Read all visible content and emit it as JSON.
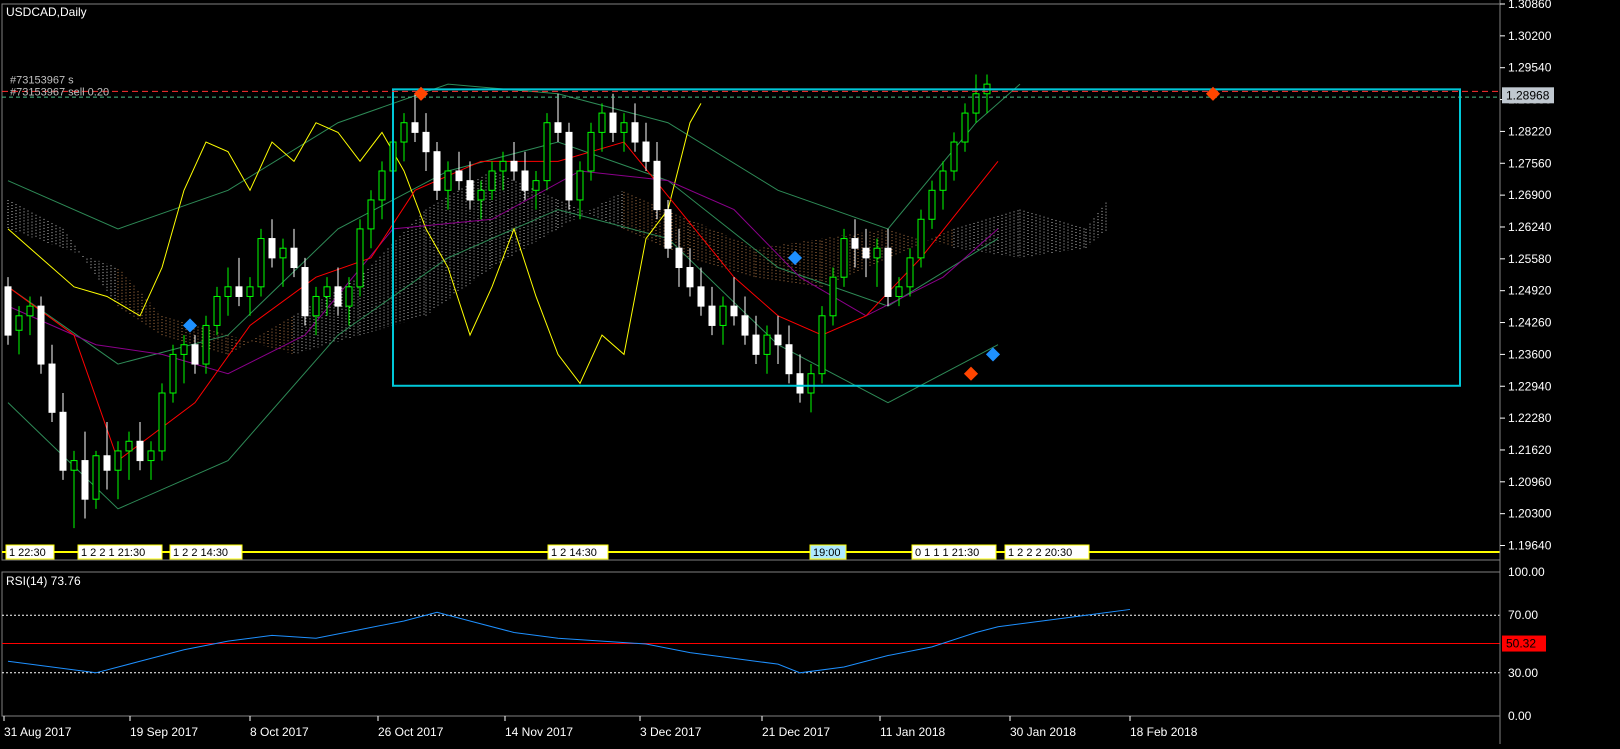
{
  "window": {
    "title": "USDCAD,Daily"
  },
  "order": {
    "label1": "#73153967 s",
    "label2": "#73153967 sell 0.20"
  },
  "colors": {
    "background": "#000000",
    "bull": "#00ff00",
    "bear": "#ffffff",
    "grid": "#ffffff",
    "box": "#00c8d8",
    "tenkan": "#ff0000",
    "kijun": "#8b008b",
    "chikou": "#ffff00",
    "bands": "#2e8b57",
    "rsi": "#1e90ff",
    "rsi_mid": "#ff0000",
    "price_tag": "#c0c8d0",
    "rsi_tag": "#ff0000"
  },
  "price_axis": {
    "ticks": [
      "1.30860",
      "1.30200",
      "1.29540",
      "1.28880",
      "1.28220",
      "1.27560",
      "1.26900",
      "1.26240",
      "1.25580",
      "1.24920",
      "1.24260",
      "1.23600",
      "1.22940",
      "1.22280",
      "1.21620",
      "1.20960",
      "1.20300",
      "1.19640"
    ],
    "current_price": "1.28968"
  },
  "rsi_panel": {
    "label": "RSI(14) 73.76",
    "ticks": [
      "100.00",
      "70.00",
      "30.00",
      "0.00"
    ],
    "level_value": "50.32"
  },
  "time_axis": {
    "labels": [
      "31 Aug 2017",
      "19 Sep 2017",
      "8 Oct 2017",
      "26 Oct 2017",
      "14 Nov 2017",
      "3 Dec 2017",
      "21 Dec 2017",
      "11 Jan 2018",
      "30 Jan 2018",
      "18 Feb 2018"
    ]
  },
  "events": [
    {
      "label": "1 22:30",
      "bg": "#ffffff"
    },
    {
      "label": "1 2 2 1 21:30",
      "bg": "#ffffff"
    },
    {
      "label": "1 2 2 14:30",
      "bg": "#ffffff"
    },
    {
      "label": "1 2 14:30",
      "bg": "#ffffff"
    },
    {
      "label": "19:00",
      "bg": "#aee9ff"
    },
    {
      "label": "0 1 1 1 21:30",
      "bg": "#ffffff"
    },
    {
      "label": "1 2 2 2 20:30",
      "bg": "#ffffff"
    }
  ],
  "chart_data": {
    "type": "candlestick",
    "symbol": "USDCAD",
    "timeframe": "Daily",
    "ylim": [
      1.1934,
      1.3086
    ],
    "candles": [
      [
        1.25,
        1.252,
        1.238,
        1.24
      ],
      [
        1.241,
        1.246,
        1.236,
        1.244
      ],
      [
        1.244,
        1.248,
        1.24,
        1.246
      ],
      [
        1.246,
        1.248,
        1.232,
        1.234
      ],
      [
        1.234,
        1.238,
        1.222,
        1.224
      ],
      [
        1.224,
        1.228,
        1.21,
        1.212
      ],
      [
        1.212,
        1.216,
        1.2,
        1.214
      ],
      [
        1.214,
        1.22,
        1.202,
        1.206
      ],
      [
        1.206,
        1.216,
        1.204,
        1.215
      ],
      [
        1.215,
        1.222,
        1.208,
        1.212
      ],
      [
        1.212,
        1.218,
        1.206,
        1.216
      ],
      [
        1.216,
        1.22,
        1.21,
        1.218
      ],
      [
        1.218,
        1.222,
        1.212,
        1.214
      ],
      [
        1.214,
        1.218,
        1.21,
        1.216
      ],
      [
        1.216,
        1.23,
        1.214,
        1.228
      ],
      [
        1.228,
        1.238,
        1.226,
        1.236
      ],
      [
        1.236,
        1.24,
        1.23,
        1.238
      ],
      [
        1.238,
        1.24,
        1.232,
        1.234
      ],
      [
        1.234,
        1.244,
        1.232,
        1.242
      ],
      [
        1.242,
        1.25,
        1.24,
        1.248
      ],
      [
        1.248,
        1.254,
        1.244,
        1.25
      ],
      [
        1.25,
        1.256,
        1.246,
        1.248
      ],
      [
        1.248,
        1.252,
        1.244,
        1.25
      ],
      [
        1.25,
        1.262,
        1.248,
        1.26
      ],
      [
        1.26,
        1.264,
        1.254,
        1.256
      ],
      [
        1.256,
        1.26,
        1.25,
        1.258
      ],
      [
        1.258,
        1.262,
        1.252,
        1.254
      ],
      [
        1.254,
        1.256,
        1.242,
        1.244
      ],
      [
        1.244,
        1.25,
        1.24,
        1.248
      ],
      [
        1.248,
        1.252,
        1.244,
        1.25
      ],
      [
        1.25,
        1.254,
        1.244,
        1.246
      ],
      [
        1.246,
        1.252,
        1.242,
        1.25
      ],
      [
        1.25,
        1.264,
        1.248,
        1.262
      ],
      [
        1.262,
        1.27,
        1.258,
        1.268
      ],
      [
        1.268,
        1.276,
        1.264,
        1.274
      ],
      [
        1.274,
        1.282,
        1.27,
        1.28
      ],
      [
        1.28,
        1.286,
        1.276,
        1.284
      ],
      [
        1.284,
        1.29,
        1.28,
        1.282
      ],
      [
        1.282,
        1.286,
        1.274,
        1.278
      ],
      [
        1.278,
        1.28,
        1.268,
        1.27
      ],
      [
        1.27,
        1.276,
        1.266,
        1.274
      ],
      [
        1.274,
        1.278,
        1.27,
        1.272
      ],
      [
        1.272,
        1.276,
        1.266,
        1.268
      ],
      [
        1.268,
        1.272,
        1.264,
        1.27
      ],
      [
        1.27,
        1.276,
        1.268,
        1.274
      ],
      [
        1.274,
        1.278,
        1.27,
        1.276
      ],
      [
        1.276,
        1.28,
        1.272,
        1.274
      ],
      [
        1.274,
        1.278,
        1.268,
        1.27
      ],
      [
        1.27,
        1.274,
        1.266,
        1.272
      ],
      [
        1.272,
        1.286,
        1.27,
        1.284
      ],
      [
        1.284,
        1.29,
        1.28,
        1.282
      ],
      [
        1.282,
        1.284,
        1.266,
        1.268
      ],
      [
        1.268,
        1.276,
        1.264,
        1.274
      ],
      [
        1.274,
        1.284,
        1.272,
        1.282
      ],
      [
        1.282,
        1.288,
        1.278,
        1.286
      ],
      [
        1.286,
        1.29,
        1.28,
        1.282
      ],
      [
        1.282,
        1.286,
        1.278,
        1.284
      ],
      [
        1.284,
        1.288,
        1.278,
        1.28
      ],
      [
        1.28,
        1.284,
        1.274,
        1.276
      ],
      [
        1.276,
        1.28,
        1.264,
        1.266
      ],
      [
        1.266,
        1.268,
        1.256,
        1.258
      ],
      [
        1.258,
        1.262,
        1.25,
        1.254
      ],
      [
        1.254,
        1.258,
        1.248,
        1.25
      ],
      [
        1.25,
        1.254,
        1.244,
        1.246
      ],
      [
        1.246,
        1.25,
        1.24,
        1.242
      ],
      [
        1.242,
        1.248,
        1.238,
        1.246
      ],
      [
        1.246,
        1.252,
        1.242,
        1.244
      ],
      [
        1.244,
        1.248,
        1.238,
        1.24
      ],
      [
        1.24,
        1.244,
        1.234,
        1.236
      ],
      [
        1.236,
        1.242,
        1.232,
        1.24
      ],
      [
        1.24,
        1.244,
        1.234,
        1.238
      ],
      [
        1.238,
        1.242,
        1.23,
        1.232
      ],
      [
        1.232,
        1.236,
        1.226,
        1.228
      ],
      [
        1.228,
        1.234,
        1.224,
        1.232
      ],
      [
        1.232,
        1.246,
        1.23,
        1.244
      ],
      [
        1.244,
        1.254,
        1.242,
        1.252
      ],
      [
        1.252,
        1.262,
        1.25,
        1.26
      ],
      [
        1.26,
        1.264,
        1.254,
        1.258
      ],
      [
        1.258,
        1.262,
        1.252,
        1.256
      ],
      [
        1.256,
        1.26,
        1.25,
        1.258
      ],
      [
        1.258,
        1.262,
        1.246,
        1.248
      ],
      [
        1.248,
        1.252,
        1.246,
        1.25
      ],
      [
        1.25,
        1.258,
        1.248,
        1.256
      ],
      [
        1.256,
        1.266,
        1.254,
        1.264
      ],
      [
        1.264,
        1.272,
        1.262,
        1.27
      ],
      [
        1.27,
        1.276,
        1.266,
        1.274
      ],
      [
        1.274,
        1.282,
        1.272,
        1.28
      ],
      [
        1.28,
        1.288,
        1.278,
        1.286
      ],
      [
        1.286,
        1.294,
        1.284,
        1.29
      ],
      [
        1.29,
        1.294,
        1.286,
        1.292
      ]
    ],
    "tenkan": [
      [
        0,
        1.25
      ],
      [
        6,
        1.24
      ],
      [
        10,
        1.214
      ],
      [
        17,
        1.226
      ],
      [
        22,
        1.242
      ],
      [
        28,
        1.252
      ],
      [
        33,
        1.256
      ],
      [
        37,
        1.27
      ],
      [
        43,
        1.276
      ],
      [
        50,
        1.276
      ],
      [
        56,
        1.28
      ],
      [
        61,
        1.266
      ],
      [
        66,
        1.252
      ],
      [
        70,
        1.244
      ],
      [
        74,
        1.24
      ],
      [
        78,
        1.244
      ],
      [
        83,
        1.256
      ],
      [
        90,
        1.276
      ]
    ],
    "kijun": [
      [
        0,
        1.246
      ],
      [
        8,
        1.238
      ],
      [
        14,
        1.236
      ],
      [
        20,
        1.232
      ],
      [
        27,
        1.24
      ],
      [
        35,
        1.262
      ],
      [
        44,
        1.264
      ],
      [
        52,
        1.274
      ],
      [
        60,
        1.272
      ],
      [
        66,
        1.266
      ],
      [
        72,
        1.252
      ],
      [
        78,
        1.244
      ],
      [
        85,
        1.252
      ],
      [
        90,
        1.262
      ]
    ],
    "chikou": [
      [
        0,
        1.262
      ],
      [
        3,
        1.256
      ],
      [
        6,
        1.25
      ],
      [
        9,
        1.248
      ],
      [
        12,
        1.244
      ],
      [
        14,
        1.254
      ],
      [
        16,
        1.27
      ],
      [
        18,
        1.28
      ],
      [
        20,
        1.278
      ],
      [
        22,
        1.27
      ],
      [
        24,
        1.28
      ],
      [
        26,
        1.276
      ],
      [
        28,
        1.284
      ],
      [
        30,
        1.282
      ],
      [
        32,
        1.276
      ],
      [
        34,
        1.282
      ],
      [
        36,
        1.274
      ],
      [
        38,
        1.262
      ],
      [
        40,
        1.254
      ],
      [
        42,
        1.24
      ],
      [
        44,
        1.25
      ],
      [
        46,
        1.262
      ],
      [
        48,
        1.248
      ],
      [
        50,
        1.236
      ],
      [
        52,
        1.23
      ],
      [
        54,
        1.24
      ],
      [
        56,
        1.236
      ],
      [
        58,
        1.26
      ],
      [
        60,
        1.266
      ],
      [
        62,
        1.284
      ],
      [
        63,
        1.288
      ]
    ],
    "bollinger": {
      "upper": [
        [
          0,
          1.272
        ],
        [
          10,
          1.262
        ],
        [
          20,
          1.27
        ],
        [
          30,
          1.284
        ],
        [
          40,
          1.292
        ],
        [
          50,
          1.29
        ],
        [
          60,
          1.284
        ],
        [
          70,
          1.27
        ],
        [
          80,
          1.262
        ],
        [
          88,
          1.284
        ],
        [
          92,
          1.292
        ]
      ],
      "middle": [
        [
          0,
          1.25
        ],
        [
          10,
          1.234
        ],
        [
          20,
          1.24
        ],
        [
          30,
          1.262
        ],
        [
          40,
          1.274
        ],
        [
          50,
          1.28
        ],
        [
          60,
          1.272
        ],
        [
          70,
          1.254
        ],
        [
          80,
          1.246
        ],
        [
          90,
          1.26
        ]
      ],
      "lower": [
        [
          0,
          1.226
        ],
        [
          10,
          1.204
        ],
        [
          20,
          1.214
        ],
        [
          30,
          1.24
        ],
        [
          40,
          1.256
        ],
        [
          50,
          1.266
        ],
        [
          60,
          1.26
        ],
        [
          70,
          1.238
        ],
        [
          80,
          1.226
        ],
        [
          90,
          1.238
        ]
      ]
    },
    "kumo": [
      [
        0,
        1.268,
        1.262
      ],
      [
        5,
        1.262,
        1.258
      ],
      [
        10,
        1.246,
        1.254
      ],
      [
        14,
        1.24,
        1.244
      ],
      [
        20,
        1.236,
        1.24
      ],
      [
        26,
        1.244,
        1.236
      ],
      [
        32,
        1.252,
        1.24
      ],
      [
        38,
        1.266,
        1.244
      ],
      [
        44,
        1.274,
        1.254
      ],
      [
        50,
        1.268,
        1.262
      ],
      [
        56,
        1.262,
        1.27
      ],
      [
        62,
        1.256,
        1.264
      ],
      [
        68,
        1.252,
        1.258
      ],
      [
        74,
        1.25,
        1.26
      ],
      [
        80,
        1.256,
        1.262
      ],
      [
        86,
        1.262,
        1.258
      ],
      [
        92,
        1.266,
        1.256
      ],
      [
        98,
        1.262,
        1.258
      ],
      [
        100,
        1.268,
        1.262
      ]
    ],
    "rsi": [
      [
        0,
        38
      ],
      [
        4,
        34
      ],
      [
        8,
        30
      ],
      [
        12,
        38
      ],
      [
        16,
        46
      ],
      [
        20,
        52
      ],
      [
        24,
        56
      ],
      [
        28,
        54
      ],
      [
        32,
        60
      ],
      [
        36,
        66
      ],
      [
        39,
        72
      ],
      [
        42,
        66
      ],
      [
        46,
        58
      ],
      [
        50,
        54
      ],
      [
        54,
        52
      ],
      [
        58,
        50
      ],
      [
        62,
        44
      ],
      [
        66,
        40
      ],
      [
        70,
        36
      ],
      [
        72,
        30
      ],
      [
        76,
        34
      ],
      [
        80,
        42
      ],
      [
        84,
        48
      ],
      [
        88,
        58
      ],
      [
        90,
        62
      ],
      [
        94,
        66
      ],
      [
        98,
        70
      ],
      [
        102,
        74
      ]
    ],
    "rsi_range": [
      0,
      100
    ],
    "rsi_levels": [
      70,
      50.32,
      30
    ],
    "trade_lines": [
      1.2905,
      1.2893
    ]
  }
}
